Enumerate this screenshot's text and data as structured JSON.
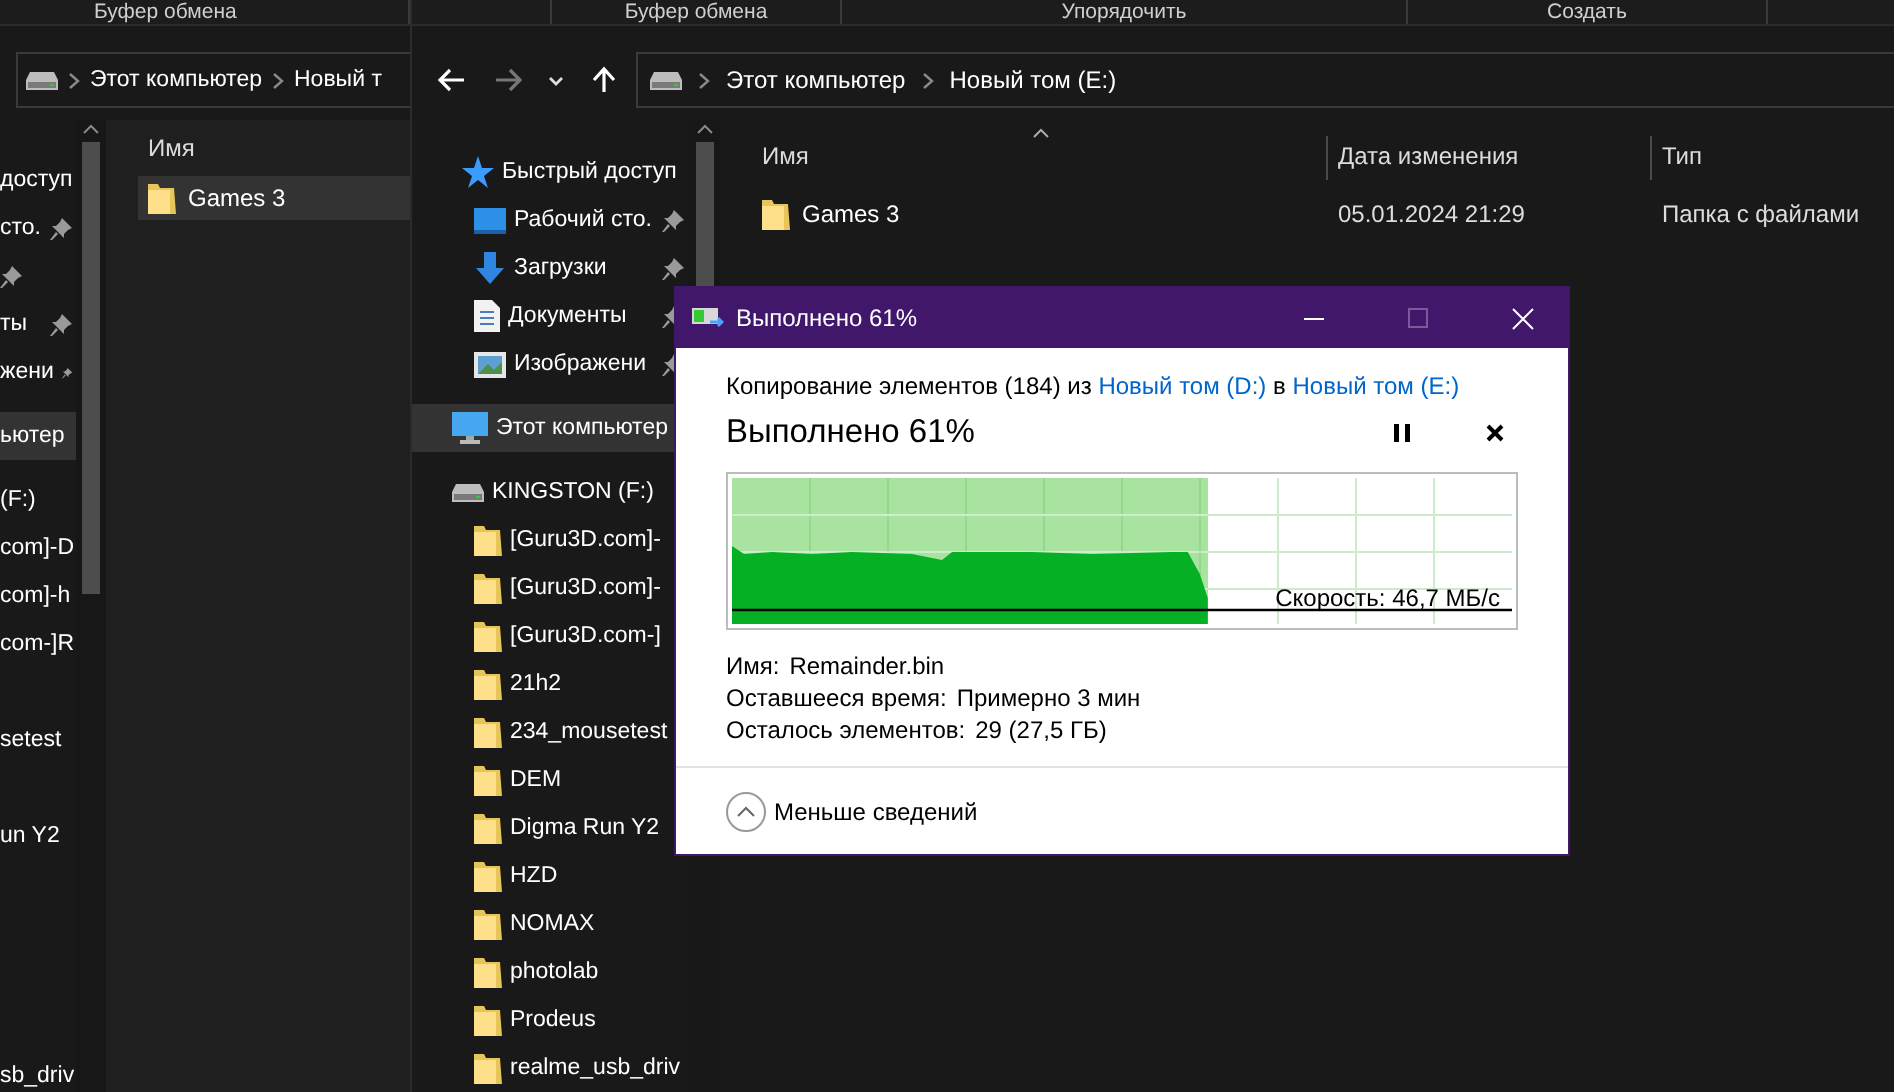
{
  "back_window": {
    "ribbon_label": "Буфер обмена",
    "address": [
      "Этот компьютер",
      "Новый т"
    ],
    "nav_items": [
      {
        "text": "доступ",
        "selected": false
      },
      {
        "text": "сто.",
        "pinned": true,
        "selected": false
      },
      {
        "pinned": true,
        "selected": false
      },
      {
        "text": "ты",
        "pinned": true,
        "selected": false
      },
      {
        "text": "жени",
        "pinned": true,
        "selected": false
      },
      {
        "text": "ьютер",
        "selected": true
      },
      {
        "text": "(F:)",
        "selected": false
      },
      {
        "text": "com]-D",
        "selected": false
      },
      {
        "text": "com]-h",
        "selected": false
      },
      {
        "text": "com-]R",
        "selected": false
      },
      {
        "selected": false
      },
      {
        "text": "setest",
        "selected": false
      },
      {
        "selected": false
      },
      {
        "text": "un Y2",
        "selected": false
      },
      {
        "selected": false
      },
      {
        "selected": false
      },
      {
        "selected": false
      },
      {
        "selected": false
      },
      {
        "text": "sb_driv",
        "selected": false
      }
    ],
    "column": "Имя",
    "rows": [
      {
        "name": "Games 3",
        "selected": true
      }
    ]
  },
  "front_window": {
    "ribbon_groups": [
      "Буфер обмена",
      "Упорядочить",
      "Создать"
    ],
    "address": [
      "Этот компьютер",
      "Новый том (E:)"
    ],
    "nav_tree": [
      {
        "text": "Быстрый доступ",
        "kind": "star",
        "selected": false,
        "children": [
          {
            "text": "Рабочий сто.",
            "kind": "desktop",
            "pinned": true,
            "selected": false
          },
          {
            "text": "Загрузки",
            "kind": "download",
            "pinned": true,
            "selected": false
          },
          {
            "text": "Документы",
            "kind": "document",
            "pinned": true,
            "selected": false
          },
          {
            "text": "Изображени",
            "kind": "image",
            "pinned": true,
            "selected": false
          }
        ]
      },
      {
        "text": "Этот компьютер",
        "kind": "computer",
        "selected": true
      },
      {
        "text": "KINGSTON (F:)",
        "kind": "drive",
        "selected": false,
        "children": [
          {
            "text": "[Guru3D.com]-",
            "kind": "folder",
            "selected": false
          },
          {
            "text": "[Guru3D.com]-",
            "kind": "folder",
            "selected": false
          },
          {
            "text": "[Guru3D.com-]",
            "kind": "folder",
            "selected": false
          },
          {
            "text": "21h2",
            "kind": "folder",
            "selected": false
          },
          {
            "text": "234_mousetest",
            "kind": "folder",
            "selected": false
          },
          {
            "text": "DEM",
            "kind": "folder",
            "selected": false
          },
          {
            "text": "Digma Run Y2",
            "kind": "folder",
            "selected": false
          },
          {
            "text": "HZD",
            "kind": "folder",
            "selected": false
          },
          {
            "text": "NOMAX",
            "kind": "folder",
            "selected": false
          },
          {
            "text": "photolab",
            "kind": "folder",
            "selected": false
          },
          {
            "text": "Prodeus",
            "kind": "folder",
            "selected": false
          },
          {
            "text": "realme_usb_driv",
            "kind": "folder",
            "selected": false
          }
        ]
      }
    ],
    "columns": [
      "Имя",
      "Дата изменения",
      "Тип"
    ],
    "rows": [
      {
        "cells": [
          "Games 3",
          "05.01.2024 21:29",
          "Папка с файлами"
        ],
        "selected": false
      }
    ]
  },
  "dialog": {
    "title": "Выполнено 61%",
    "summary": {
      "before": "Копирование элементов (184) из ",
      "source": "Новый том (D:)",
      "middle": " в ",
      "target": "Новый том (E:)"
    },
    "heading": "Выполнено 61%",
    "progress": {
      "level": 0.61,
      "speed": "Скорость: 46,7 МБ/с"
    },
    "details": [
      {
        "label": "Имя:",
        "value": "Remainder.bin"
      },
      {
        "label": "Оставшееся время:",
        "value": "Примерно 3 мин"
      },
      {
        "label": "Осталось элементов:",
        "value": "29 (27,5 ГБ)"
      }
    ],
    "toggle": "Меньше сведений"
  }
}
